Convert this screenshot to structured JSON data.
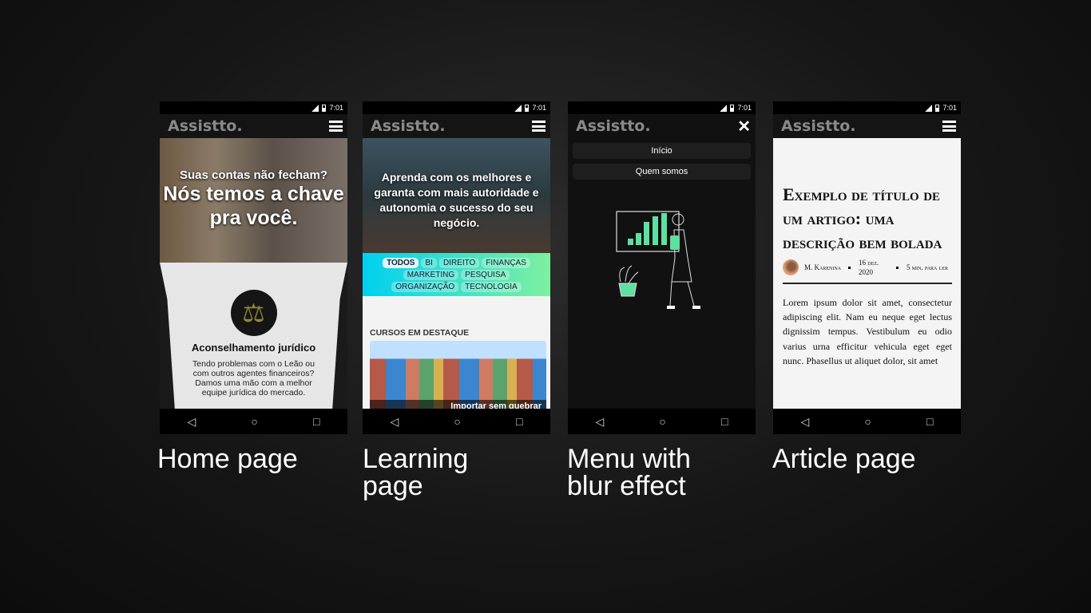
{
  "status": {
    "time": "7:01"
  },
  "brand": "Assistto.",
  "nav": {
    "back": "◁",
    "home": "○",
    "recent": "□"
  },
  "home": {
    "subtitle": "Suas contas não fecham?",
    "headline": "Nós temos a chave pra você.",
    "service_icon": "scales-icon",
    "service_title": "Aconselhamento jurídico",
    "service_desc": "Tendo problemas com o Leão ou com outros agentes financeiros? Damos uma mão com a melhor equipe jurídica do mercado.",
    "caption": "Home page"
  },
  "learning": {
    "headline": "Aprenda com os melhores e garanta com mais autoridade e autonomia o sucesso do seu negócio.",
    "tags": [
      "TODOS",
      "BI",
      "DIREITO",
      "FINANÇAS",
      "MARKETING",
      "PESQUISA",
      "ORGANIZAÇÃO",
      "TECNOLOGIA"
    ],
    "section": "CURSOS EM DESTAQUE",
    "course": "Importar sem quebrar",
    "caption": "Learning page"
  },
  "menu": {
    "items": [
      "Início",
      "Quem somos"
    ],
    "caption": "Menu with blur effect"
  },
  "article": {
    "title": "Exemplo de título de um artigo: uma descrição bem bolada",
    "author": "M. Karenina",
    "date": "16 dez. 2020",
    "read": "5 min. para ler",
    "body": "Lorem ipsum dolor sit amet, consectetur adipiscing elit. Nam eu neque eget lectus dignissim tempus. Vestibulum eu odio varius urna efficitur vehicula eget eget nunc. Phasellus ut aliquet dolor, sit amet",
    "caption": "Article page"
  },
  "colors": {
    "accent": "#5ee0a0",
    "bg": "#161616"
  }
}
